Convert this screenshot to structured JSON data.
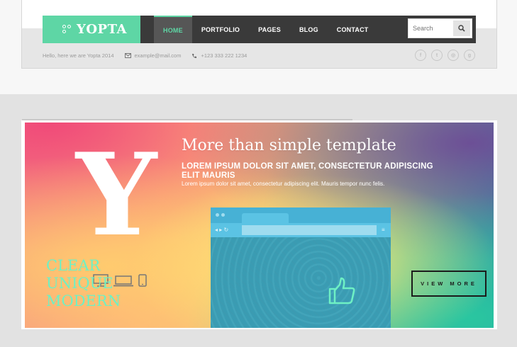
{
  "brand": {
    "logo_text": "YOPTA",
    "accent": "#5ed6a5"
  },
  "nav": {
    "items": [
      {
        "label": "HOME",
        "active": true
      },
      {
        "label": "PORTFOLIO",
        "active": false
      },
      {
        "label": "PAGES",
        "active": false
      },
      {
        "label": "BLOG",
        "active": false
      },
      {
        "label": "CONTACT",
        "active": false
      }
    ]
  },
  "search": {
    "placeholder": "Search",
    "icon": "search-icon"
  },
  "info": {
    "tagline": "Hello, here we are Yopta 2014",
    "email": "example@mail.com",
    "phone": "+123 333 222 1234"
  },
  "socials": [
    {
      "icon": "facebook-icon",
      "glyph": "f"
    },
    {
      "icon": "twitter-icon",
      "glyph": "t"
    },
    {
      "icon": "dribbble-icon",
      "glyph": "◎"
    },
    {
      "icon": "google-plus-icon",
      "glyph": "g"
    }
  ],
  "slider": {
    "big_letter": "Y",
    "headline": "More than simple template",
    "subhead": "LOREM IPSUM DOLOR SIT AMET, CONSECTETUR ADIPISCING ELIT MAURIS",
    "subtext": "Lorem ipsum dolor sit amet, consectetur adipiscing elit. Mauris tempor nunc felis.",
    "browser_words": [
      "CLEAR",
      "UNIQUE",
      "MODERN"
    ],
    "cta_label": "VIEW MORE"
  }
}
